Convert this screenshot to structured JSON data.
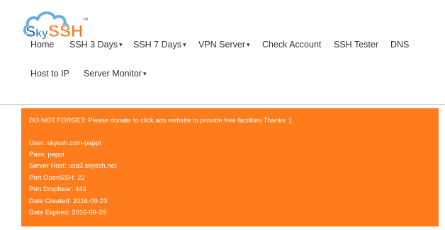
{
  "logo": {
    "text": "SkySSH",
    "trademark": "TM",
    "colors": {
      "cloud": "#6aaee0",
      "sky": "#2d6fb1",
      "ssh": "#f47a20"
    }
  },
  "nav": {
    "items": [
      {
        "label": "Home",
        "has_dropdown": false
      },
      {
        "label": "SSH 3 Days",
        "has_dropdown": true
      },
      {
        "label": "SSH 7 Days",
        "has_dropdown": true
      },
      {
        "label": "VPN Server",
        "has_dropdown": true
      },
      {
        "label": "Check Account",
        "has_dropdown": false
      },
      {
        "label": "SSH Tester",
        "has_dropdown": false
      },
      {
        "label": "DNS",
        "has_dropdown": false
      },
      {
        "label": "Host to IP",
        "has_dropdown": false
      },
      {
        "label": "Server Monitor",
        "has_dropdown": true
      }
    ],
    "caret": "▾"
  },
  "notice": {
    "background": "#fe7c1b",
    "message": "DO NOT FORGET: Please donate to click ads website to provide free facilities Thanks :)",
    "user": "User: skyssh.com-pappi",
    "pass": "Pass: pappi",
    "server_host": "Server Host: usa3.skyssh.net",
    "port_openssh": "Port OpenSSH: 22",
    "port_dropbear": "Port Dropbear: 443",
    "date_created": "Date Created: 2016-09-23",
    "date_expired": "Date Expired: 2016-09-29"
  }
}
